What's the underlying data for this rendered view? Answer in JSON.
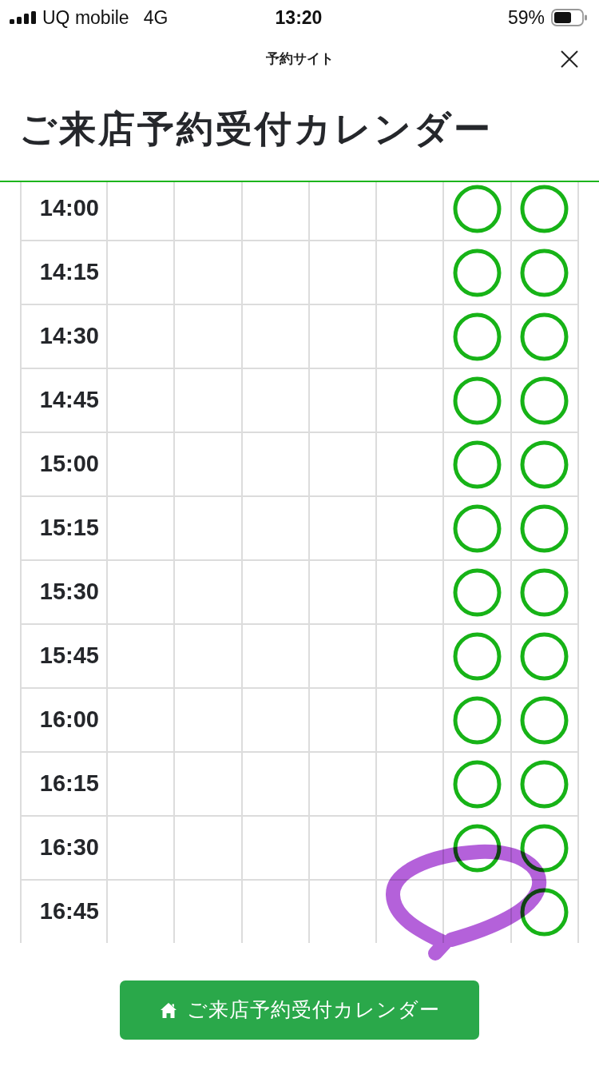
{
  "status_bar": {
    "carrier": "UQ mobile",
    "network": "4G",
    "time": "13:20",
    "battery": "59%"
  },
  "header": {
    "title": "予約サイト"
  },
  "page": {
    "title": "ご来店予約受付カレンダー"
  },
  "schedule": {
    "rows": [
      {
        "time": "14:00",
        "open": [
          false,
          false,
          false,
          false,
          false,
          true,
          true
        ]
      },
      {
        "time": "14:15",
        "open": [
          false,
          false,
          false,
          false,
          false,
          true,
          true
        ]
      },
      {
        "time": "14:30",
        "open": [
          false,
          false,
          false,
          false,
          false,
          true,
          true
        ]
      },
      {
        "time": "14:45",
        "open": [
          false,
          false,
          false,
          false,
          false,
          true,
          true
        ]
      },
      {
        "time": "15:00",
        "open": [
          false,
          false,
          false,
          false,
          false,
          true,
          true
        ]
      },
      {
        "time": "15:15",
        "open": [
          false,
          false,
          false,
          false,
          false,
          true,
          true
        ]
      },
      {
        "time": "15:30",
        "open": [
          false,
          false,
          false,
          false,
          false,
          true,
          true
        ]
      },
      {
        "time": "15:45",
        "open": [
          false,
          false,
          false,
          false,
          false,
          true,
          true
        ]
      },
      {
        "time": "16:00",
        "open": [
          false,
          false,
          false,
          false,
          false,
          true,
          true
        ]
      },
      {
        "time": "16:15",
        "open": [
          false,
          false,
          false,
          false,
          false,
          true,
          true
        ]
      },
      {
        "time": "16:30",
        "open": [
          false,
          false,
          false,
          false,
          false,
          true,
          true
        ]
      },
      {
        "time": "16:45",
        "open": [
          false,
          false,
          false,
          false,
          false,
          false,
          true
        ]
      }
    ]
  },
  "button": {
    "label": "ご来店予約受付カレンダー"
  }
}
